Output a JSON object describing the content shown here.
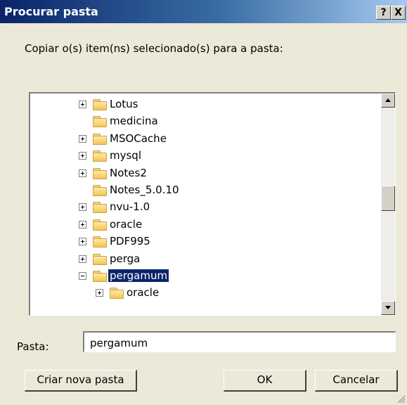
{
  "dialog": {
    "title": "Procurar pasta",
    "help_button": "?",
    "close_button": "X",
    "prompt": "Copiar o(s) item(ns) selecionado(s) para a pasta:"
  },
  "tree": {
    "items": [
      {
        "label": "Lotus",
        "expandable": true,
        "level": 0
      },
      {
        "label": "medicina",
        "expandable": false,
        "level": 0
      },
      {
        "label": "MSOCache",
        "expandable": true,
        "level": 0
      },
      {
        "label": "mysql",
        "expandable": true,
        "level": 0
      },
      {
        "label": "Notes2",
        "expandable": true,
        "level": 0
      },
      {
        "label": "Notes_5.0.10",
        "expandable": false,
        "level": 0
      },
      {
        "label": "nvu-1.0",
        "expandable": true,
        "level": 0
      },
      {
        "label": "oracle",
        "expandable": true,
        "level": 0
      },
      {
        "label": "PDF995",
        "expandable": true,
        "level": 0
      },
      {
        "label": "perga",
        "expandable": true,
        "level": 0
      },
      {
        "label": "pergamum",
        "expandable": true,
        "expanded": true,
        "selected": true,
        "level": 0
      },
      {
        "label": "oracle",
        "expandable": true,
        "level": 1
      }
    ]
  },
  "folder": {
    "label": "Pasta:",
    "value": "pergamum"
  },
  "buttons": {
    "new_folder": "Criar nova pasta",
    "ok": "OK",
    "cancel": "Cancelar"
  },
  "colors": {
    "face": "#ECE9D8",
    "title_start": "#0A246A",
    "title_end": "#A6CAF0",
    "selection": "#0A246A",
    "folder": "#F3C552"
  }
}
